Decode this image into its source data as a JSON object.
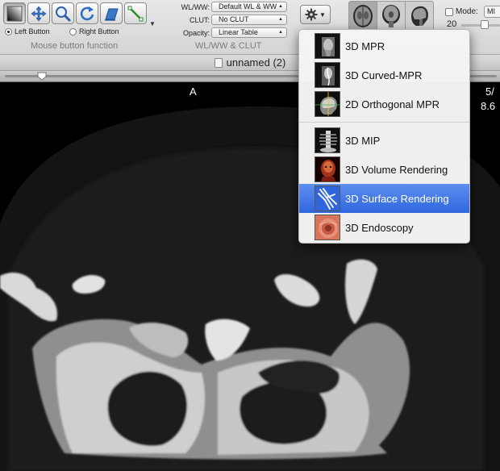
{
  "toolbar": {
    "tools": [
      {
        "icon": "wl-ww-icon",
        "selected": true
      },
      {
        "icon": "move-icon",
        "selected": false
      },
      {
        "icon": "zoom-icon",
        "selected": false
      },
      {
        "icon": "rotate-icon",
        "selected": false
      },
      {
        "icon": "scroll-stack-icon",
        "selected": false
      },
      {
        "icon": "length-measure-icon",
        "selected": false
      }
    ],
    "left_button_label": "Left Button",
    "right_button_label": "Right Button",
    "mouse_section_label": "Mouse button function",
    "wl_label": "WL/WW:",
    "wl_value": "Default WL & WW",
    "clut_label": "CLUT:",
    "clut_value": "No CLUT",
    "opacity_label": "Opacity:",
    "opacity_value": "Linear Table",
    "wl_section_label": "WL/WW & CLUT",
    "mode_label": "Mode:",
    "mode_select_value": "MI",
    "mode_number": "20"
  },
  "window": {
    "title": "unnamed (2)"
  },
  "viewer": {
    "orientation_top": "A",
    "info_right_1": "5/",
    "info_right_2": "8.6"
  },
  "menu": {
    "items": [
      {
        "label": "3D MPR",
        "icon": "mpr-thumb-icon",
        "highlighted": false
      },
      {
        "label": "3D Curved-MPR",
        "icon": "curved-mpr-thumb-icon",
        "highlighted": false
      },
      {
        "label": "2D Orthogonal MPR",
        "icon": "orthogonal-mpr-thumb-icon",
        "highlighted": false
      },
      {
        "label": "3D MIP",
        "icon": "mip-thumb-icon",
        "highlighted": false
      },
      {
        "label": "3D Volume Rendering",
        "icon": "volume-rendering-thumb-icon",
        "highlighted": false
      },
      {
        "label": "3D Surface Rendering",
        "icon": "surface-rendering-thumb-icon",
        "highlighted": true
      },
      {
        "label": "3D Endoscopy",
        "icon": "endoscopy-thumb-icon",
        "highlighted": false
      }
    ]
  },
  "colors": {
    "menu_highlight": "#2f66de",
    "viewer_background": "#000000"
  }
}
